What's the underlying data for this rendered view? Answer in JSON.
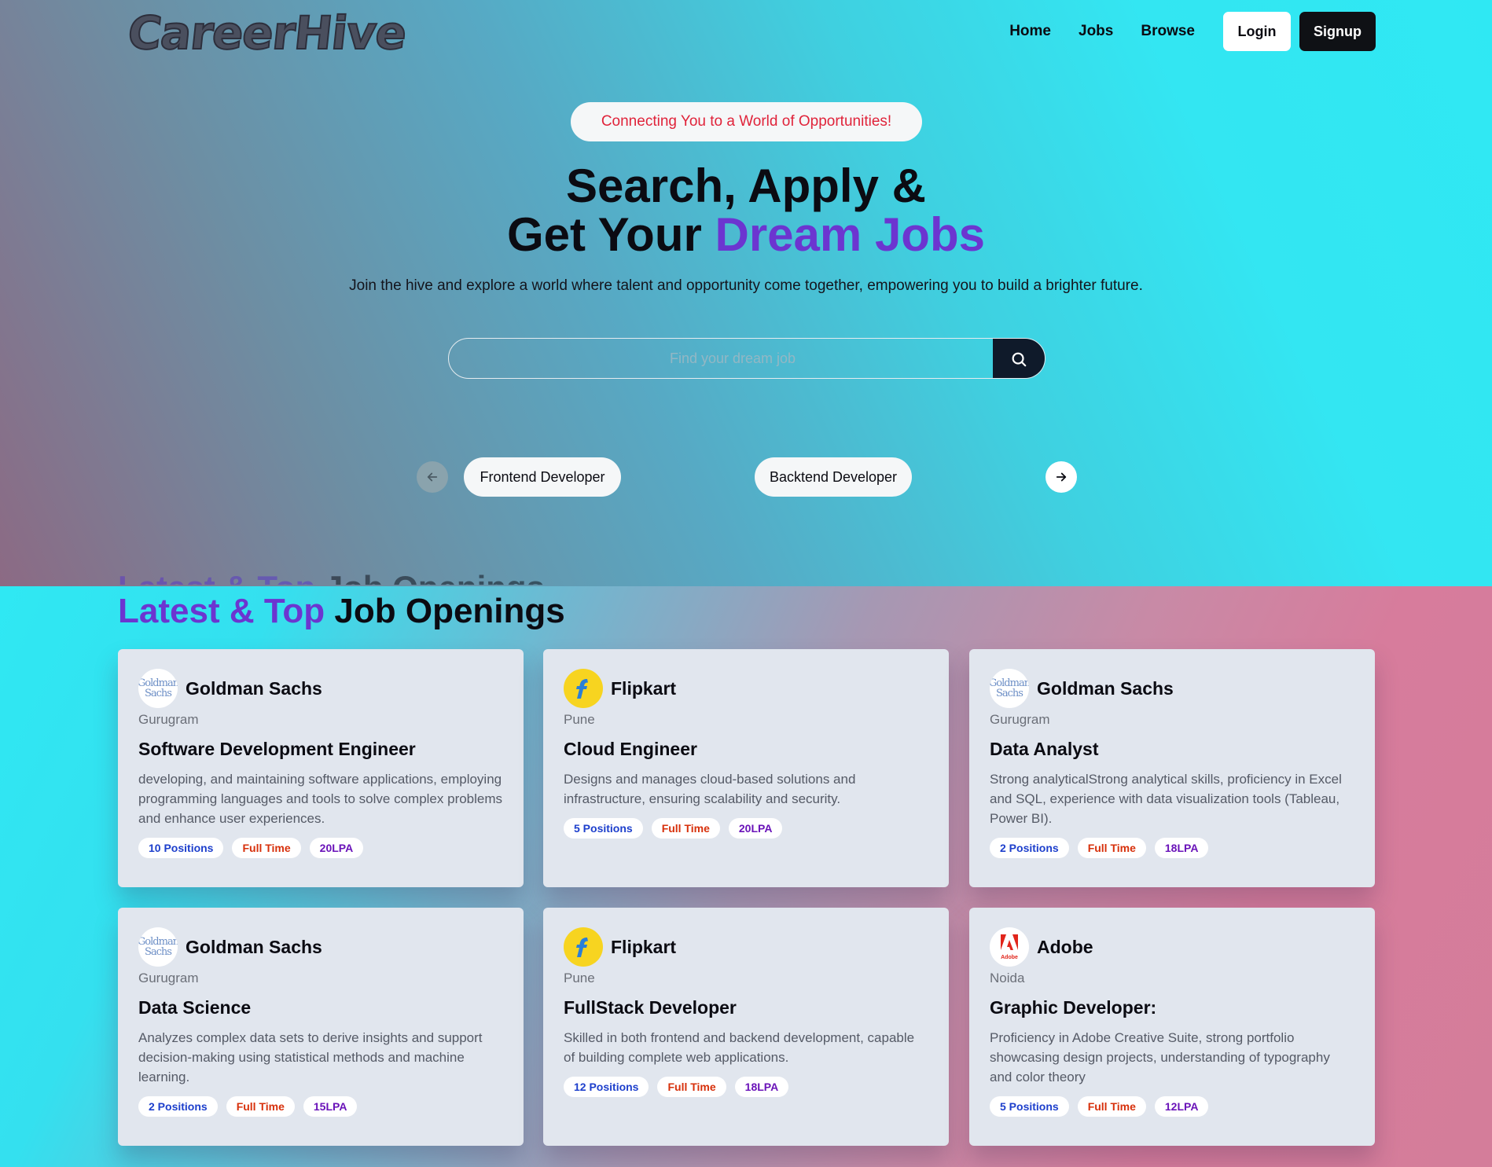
{
  "header": {
    "logo": "CareerHive",
    "nav": [
      "Home",
      "Jobs",
      "Browse"
    ],
    "login_label": "Login",
    "signup_label": "Signup"
  },
  "hero": {
    "tagline": "Connecting You to a World of Opportunities!",
    "headline_line1": "Search, Apply &",
    "headline_line2_plain": "Get Your ",
    "headline_line2_accent": "Dream Jobs",
    "subtext": "Join the hive and explore a world where talent and opportunity come together, empowering you to build a brighter future.",
    "search_placeholder": "Find your dream job",
    "categories": [
      "Frontend Developer",
      "Backtend Developer"
    ]
  },
  "jobs_section": {
    "title_accent": "Latest & Top",
    "title_plain": " Job Openings",
    "jobs": [
      {
        "company": "Goldman Sachs",
        "logo": "goldman-sachs-logo",
        "location": "Gurugram",
        "title": "Software Development Engineer",
        "description": "developing, and maintaining software applications, employing programming languages and tools to solve complex problems and enhance user experiences.",
        "positions": "10 Positions",
        "type": "Full Time",
        "salary": "20LPA"
      },
      {
        "company": "Flipkart",
        "logo": "flipkart-logo",
        "location": "Pune",
        "title": "Cloud Engineer",
        "description": "Designs and manages cloud-based solutions and infrastructure, ensuring scalability and security.",
        "positions": "5 Positions",
        "type": "Full Time",
        "salary": "20LPA"
      },
      {
        "company": "Goldman Sachs",
        "logo": "goldman-sachs-logo",
        "location": "Gurugram",
        "title": "Data Analyst",
        "description": "Strong analyticalStrong analytical skills, proficiency in Excel and SQL, experience with data visualization tools (Tableau, Power BI).",
        "positions": "2 Positions",
        "type": "Full Time",
        "salary": "18LPA"
      },
      {
        "company": "Goldman Sachs",
        "logo": "goldman-sachs-logo",
        "location": "Gurugram",
        "title": "Data Science",
        "description": "Analyzes complex data sets to derive insights and support decision-making using statistical methods and machine learning.",
        "positions": "2 Positions",
        "type": "Full Time",
        "salary": "15LPA"
      },
      {
        "company": "Flipkart",
        "logo": "flipkart-logo",
        "location": "Pune",
        "title": "FullStack Developer",
        "description": "Skilled in both frontend and backend development, capable of building complete web applications.",
        "positions": "12 Positions",
        "type": "Full Time",
        "salary": "18LPA"
      },
      {
        "company": "Adobe",
        "logo": "adobe-logo",
        "location": "Noida",
        "title": "Graphic Developer:",
        "description": "Proficiency in Adobe Creative Suite, strong portfolio showcasing design projects, understanding of typography and color theory",
        "positions": "5 Positions",
        "type": "Full Time",
        "salary": "12LPA"
      }
    ]
  },
  "logo_text": {
    "goldman_line1": "Goldman",
    "goldman_line2": "Sachs",
    "adobe_word": "Adobe"
  },
  "colors": {
    "accent_purple": "#6c35d0",
    "tagline_red": "#e0233a",
    "dark_button": "#0f1115"
  }
}
